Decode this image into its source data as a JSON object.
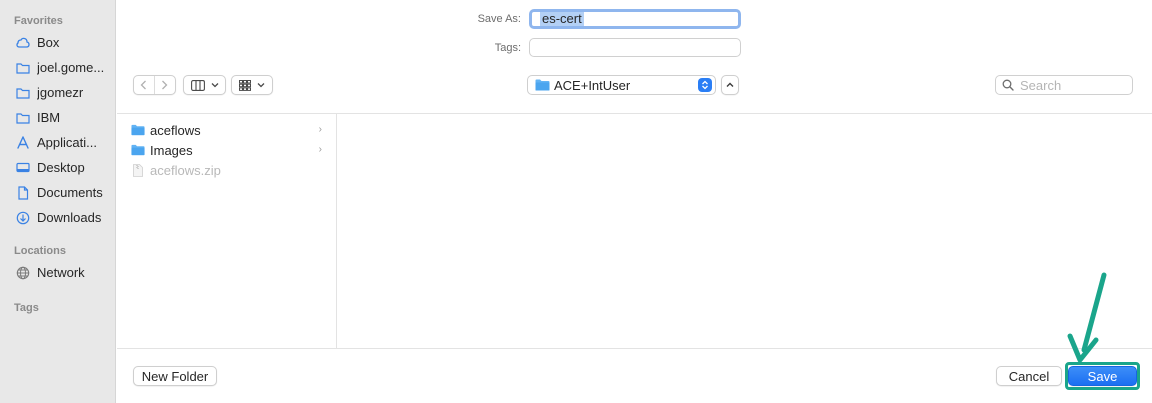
{
  "sidebar": {
    "sections": {
      "favorites": "Favorites",
      "locations": "Locations",
      "tags": "Tags"
    },
    "favorites": [
      {
        "label": "Box",
        "icon": "cloud-icon"
      },
      {
        "label": "joel.gome...",
        "icon": "folder-icon"
      },
      {
        "label": "jgomezr",
        "icon": "folder-icon"
      },
      {
        "label": "IBM",
        "icon": "folder-icon"
      },
      {
        "label": "Applicati...",
        "icon": "applications-icon"
      },
      {
        "label": "Desktop",
        "icon": "desktop-icon"
      },
      {
        "label": "Documents",
        "icon": "document-icon"
      },
      {
        "label": "Downloads",
        "icon": "download-icon"
      }
    ],
    "locations": [
      {
        "label": "Network",
        "icon": "globe-icon"
      }
    ]
  },
  "form": {
    "save_as_label": "Save As:",
    "save_as_value": "es-cert",
    "tags_label": "Tags:",
    "tags_value": ""
  },
  "toolbar": {
    "location": "ACE+IntUser",
    "search_placeholder": "Search"
  },
  "files": [
    {
      "name": "aceflows",
      "type": "folder",
      "enabled": true
    },
    {
      "name": "Images",
      "type": "folder",
      "enabled": true
    },
    {
      "name": "aceflows.zip",
      "type": "file",
      "enabled": false
    }
  ],
  "buttons": {
    "new_folder": "New Folder",
    "cancel": "Cancel",
    "save": "Save"
  },
  "colors": {
    "accent": "#1b6ff2",
    "folder": "#4ba5ef",
    "annotation": "#1aa58b"
  }
}
